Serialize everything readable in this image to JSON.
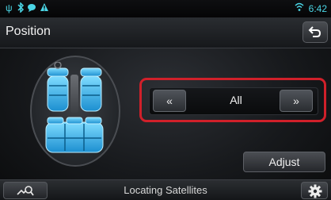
{
  "status_bar": {
    "time": "6:42",
    "icons": [
      "usb-icon",
      "bluetooth-icon",
      "messaging-icon",
      "warning-icon",
      "wifi-icon"
    ]
  },
  "header": {
    "title": "Position",
    "back_icon": "back-arrow-icon"
  },
  "selector": {
    "prev_label": "«",
    "next_label": "»",
    "value": "All",
    "highlight_color": "#d0202a"
  },
  "adjust": {
    "label": "Adjust"
  },
  "bottom_bar": {
    "status_text": "Locating Satellites",
    "left_icon": "camera-search-icon",
    "right_icon": "settings-gear-icon"
  },
  "colors": {
    "accent": "#4bd6e6",
    "seat_blue": "#2bb3e8"
  }
}
